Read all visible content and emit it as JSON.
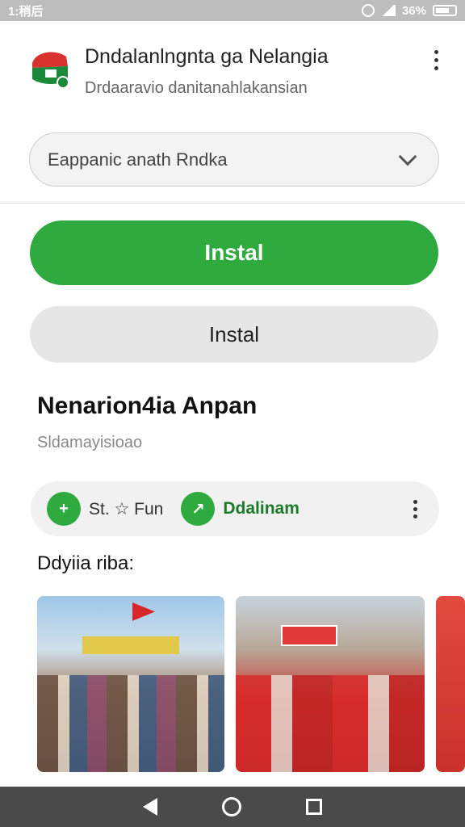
{
  "status_bar": {
    "time": "1:稍后",
    "battery": "36%"
  },
  "app": {
    "title": "Dndalanlngnta ga Nelangia",
    "subtitle": "Drdaaravio danitanahlakansian"
  },
  "select": {
    "value": "Eappanic anath Rndka"
  },
  "buttons": {
    "primary": "Instal",
    "secondary": "Instal"
  },
  "section": {
    "title": "Nenarion4ia Anpan",
    "subtitle": "Sldamayisioao"
  },
  "actions": [
    {
      "label": "St. ☆ Fun",
      "icon": "calendar-add-icon"
    },
    {
      "label": "Ddalinam",
      "icon": "share-arrow-icon"
    }
  ],
  "gallery": {
    "label": "Ddyiia riba:"
  },
  "colors": {
    "accent": "#2eaa3f",
    "secondary_bg": "#e6e6e6",
    "nav": "#4a4a4a"
  }
}
